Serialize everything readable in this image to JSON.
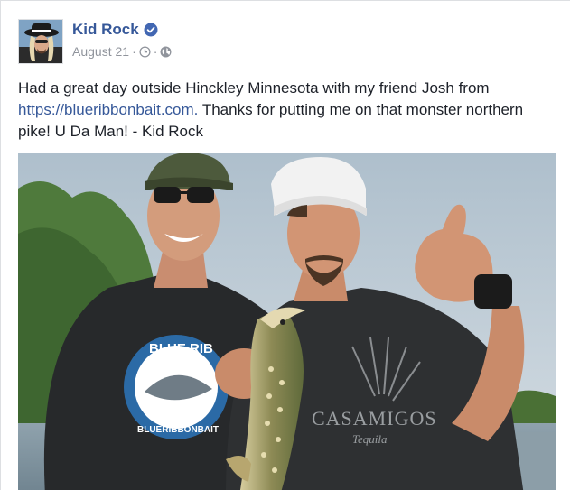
{
  "post": {
    "author": "Kid Rock",
    "date": "August 21",
    "text_before": "Had a great day outside Hinckley Minnesota with my friend Josh from ",
    "link": "https://blueribbonbait.com.",
    "text_after": " Thanks for putting me on that monster northern pike! U Da Man! - Kid Rock",
    "photo_text": {
      "shirt_logo": "BLUE RIB",
      "shirt_logo_arc": "BLUERIBBONBAIT",
      "shirt_brand": "CASAMIGOS",
      "shirt_brand_sub": "Tequila"
    }
  },
  "icons": {
    "verified": "verified-badge-icon",
    "clock": "clock-icon",
    "audience": "globe-icon"
  },
  "colors": {
    "author_link": "#365899",
    "meta": "#90949c",
    "verified": "#4267b2",
    "text": "#1d2129"
  }
}
